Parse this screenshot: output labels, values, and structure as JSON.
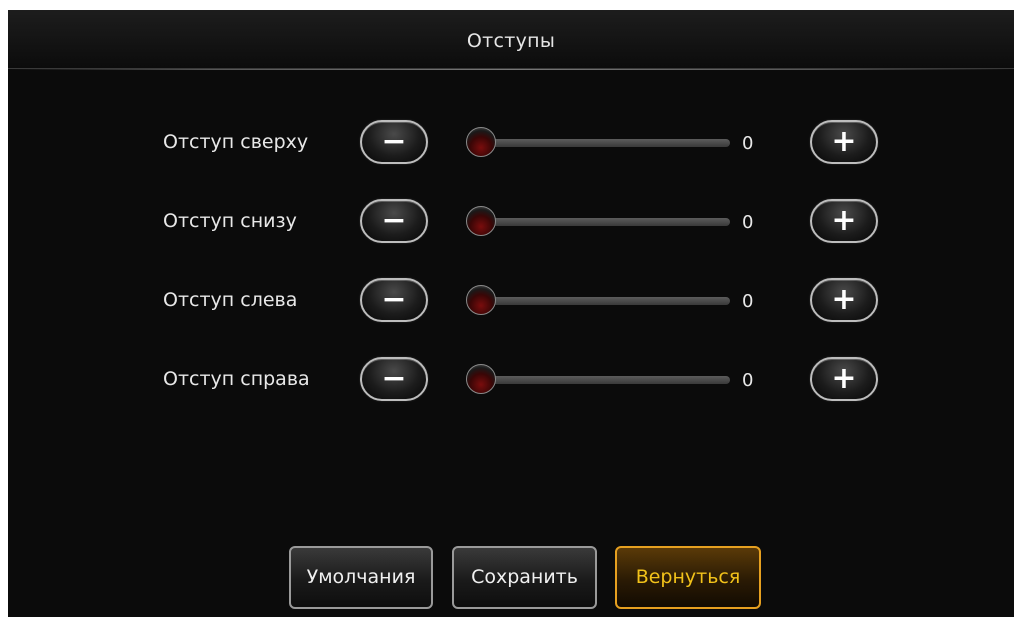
{
  "window": {
    "title": "Отступы"
  },
  "rows": [
    {
      "label": "Отступ сверху",
      "value": "0",
      "slider_fraction": 0,
      "minus_symbol": "−",
      "plus_symbol": "+"
    },
    {
      "label": "Отступ снизу",
      "value": "0",
      "slider_fraction": 0,
      "minus_symbol": "−",
      "plus_symbol": "+"
    },
    {
      "label": "Отступ слева",
      "value": "0",
      "slider_fraction": 0,
      "minus_symbol": "−",
      "plus_symbol": "+"
    },
    {
      "label": "Отступ справа",
      "value": "0",
      "slider_fraction": 0,
      "minus_symbol": "−",
      "plus_symbol": "+"
    }
  ],
  "buttons": {
    "defaults_label": "Умолчания",
    "save_label": "Сохранить",
    "back_label": "Вернуться"
  },
  "colors": {
    "background": "#0b0b0b",
    "accent": "#f2c21a",
    "text": "#e8e8e8",
    "slider_thumb": "#7a0d0d"
  },
  "icons": {
    "decrease": "minus-icon",
    "increase": "plus-icon"
  }
}
